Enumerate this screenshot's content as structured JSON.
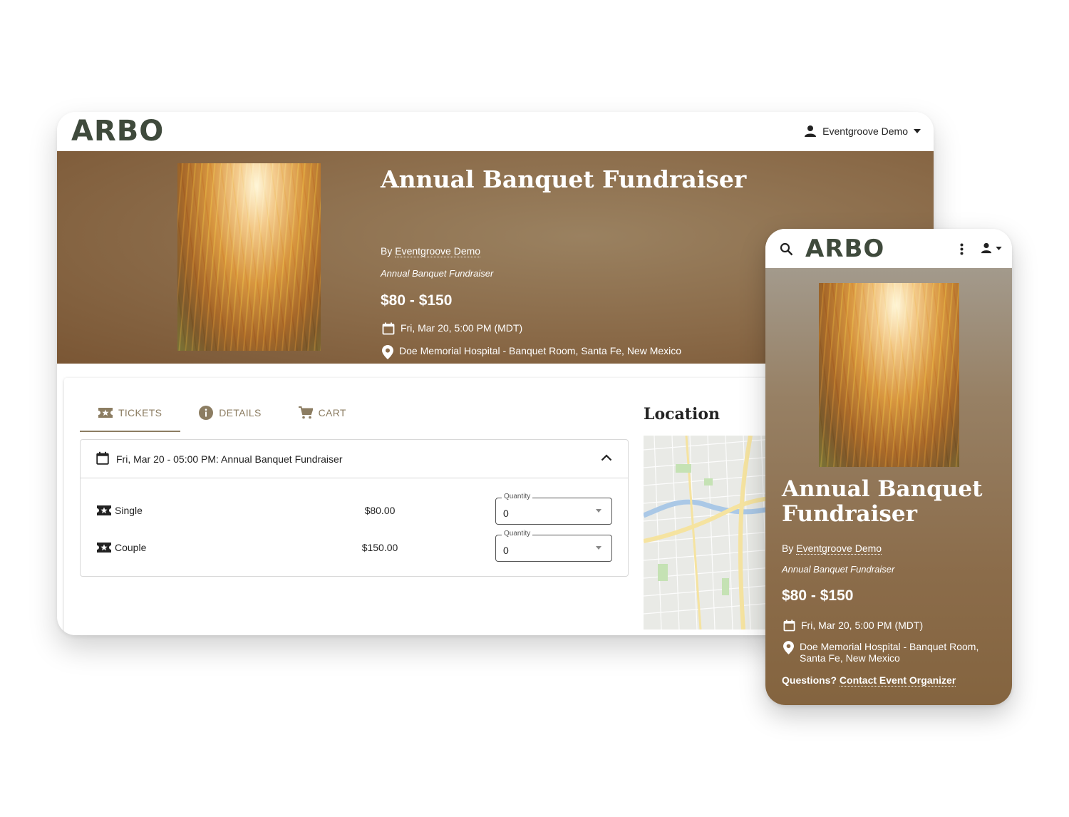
{
  "brand": {
    "logo": "ARBO"
  },
  "account": {
    "label": "Eventgroove Demo"
  },
  "event": {
    "title": "Annual Banquet Fundraiser",
    "by_prefix": "By",
    "organizer": "Eventgroove Demo",
    "subtitle": "Annual Banquet Fundraiser",
    "price_range": "$80 - $150",
    "datetime": "Fri, Mar 20, 5:00 PM (MDT)",
    "venue": "Doe Memorial Hospital - Banquet Room, Santa Fe, New Mexico"
  },
  "tabs": [
    {
      "label": "TICKETS",
      "icon": "ticket-icon",
      "active": true
    },
    {
      "label": "DETAILS",
      "icon": "info-icon",
      "active": false
    },
    {
      "label": "CART",
      "icon": "cart-icon",
      "active": false
    }
  ],
  "session": {
    "label": "Fri, Mar 20 - 05:00 PM: Annual Banquet Fundraiser",
    "tickets": [
      {
        "name": "Single",
        "price": "$80.00",
        "quantity_label": "Quantity",
        "quantity": "0"
      },
      {
        "name": "Couple",
        "price": "$150.00",
        "quantity_label": "Quantity",
        "quantity": "0"
      }
    ]
  },
  "location": {
    "title": "Location"
  },
  "mobile": {
    "title_line1": "Annual Banquet",
    "title_line2": "Fundraiser",
    "venue_line1": "Doe Memorial Hospital - Banquet Room,",
    "venue_line2": "Santa Fe, New Mexico",
    "questions_prefix": "Questions?",
    "questions_link": "Contact Event Organizer"
  },
  "colors": {
    "accent": "#8c7d62",
    "hero": "#8a6a48",
    "logo": "#3f4a3c"
  }
}
